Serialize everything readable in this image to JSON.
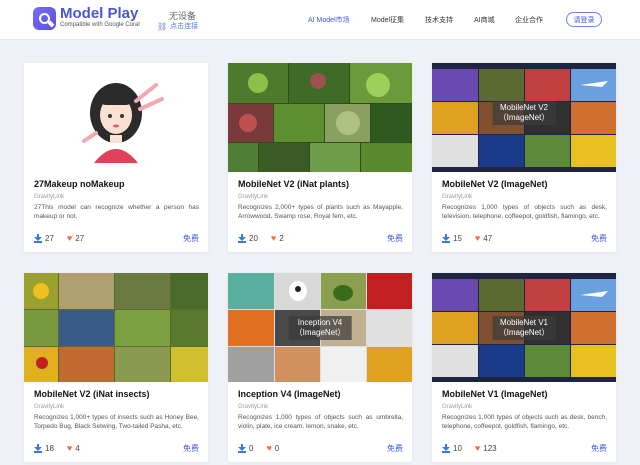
{
  "header": {
    "brand": "Model Play",
    "tagline": "Compatible with Google Coral",
    "device_status": "无设备",
    "device_link": "点击连接",
    "nav": [
      "AI Model市场",
      "Model征集",
      "技术支持",
      "AI商城",
      "企业合作"
    ],
    "login": "请登录"
  },
  "cards": [
    {
      "title": "27Makeup noMakeup",
      "author": "GravityLink",
      "desc": "27This model can recognize whether a person has makeup or not.",
      "downloads": "27",
      "likes": "27",
      "price": "免费",
      "overlay": ""
    },
    {
      "title": "MobileNet V2 (iNat plants)",
      "author": "GravityLink",
      "desc": "Recognizes 2,000+ types of plants such as Mayapple, Arrowwood, Swamp rose, Royal fern, etc.",
      "downloads": "20",
      "likes": "2",
      "price": "免费",
      "overlay": ""
    },
    {
      "title": "MobileNet V2 (ImageNet)",
      "author": "GravityLink",
      "desc": "Recognizes 1,000 types of objects such as desk, television, telephone, coffeepot, goldfish, flamingo, etc.",
      "downloads": "15",
      "likes": "47",
      "price": "免费",
      "overlay": "MobileNet V2\n（ImageNet）"
    },
    {
      "title": "MobileNet V2 (iNat insects)",
      "author": "GravityLink",
      "desc": "Recognizes 1,000+ types of insects such as Honey Bee, Torpedo Bug, Black Setwing, Two-tailed Pasha, etc.",
      "downloads": "18",
      "likes": "4",
      "price": "免费",
      "overlay": ""
    },
    {
      "title": "Inception V4 (ImageNet)",
      "author": "GravityLink",
      "desc": "Recognizes 1,000 types of objects such as umbrella, violin, plate, ice cream, lemon, snake, etc.",
      "downloads": "0",
      "likes": "0",
      "price": "免费",
      "overlay": "Inception V4\n（ImageNet）"
    },
    {
      "title": "MobileNet V1 (ImageNet)",
      "author": "GravityLink",
      "desc": "Recognizes 1,000 types of objects such as desk, bench, telephone, coffeepot, goldfish, flamingo, etc.",
      "downloads": "10",
      "likes": "123",
      "price": "免费",
      "overlay": "MobileNet V1\n（ImageNet）"
    }
  ]
}
